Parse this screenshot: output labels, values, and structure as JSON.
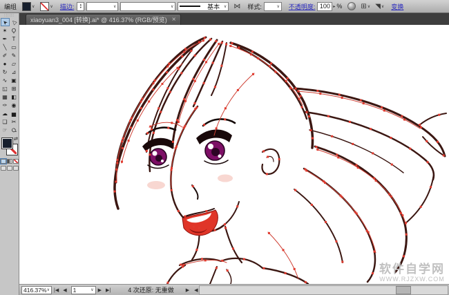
{
  "control_bar": {
    "group_label": "编组",
    "stroke_label": "描边:",
    "brush_name": "基本",
    "style_label": "样式:",
    "opacity_label": "不透明度:",
    "opacity_value": "100",
    "opacity_arrow": "▸",
    "percent_sign": "%",
    "recolor_glyph": "⋈",
    "grid_glyph": "⊞",
    "isolate_glyph": "◥",
    "dropdown_glyph": "∨",
    "transform_label": "变换"
  },
  "tab_bar": {
    "document_title": "xiaoyuan3_004 [转换].ai* @ 416.37% (RGB/预览)",
    "close_glyph": "×"
  },
  "toolbox": {
    "grip_glyph": "∷∷∷",
    "swap_glyph": "⇄",
    "tools": [
      {
        "name": "selection",
        "glyph": "➤"
      },
      {
        "name": "direct-selection",
        "glyph": "▷"
      },
      {
        "name": "magic-wand",
        "glyph": "✶"
      },
      {
        "name": "lasso",
        "glyph": "Ϙ"
      },
      {
        "name": "pen",
        "glyph": "✒"
      },
      {
        "name": "type",
        "glyph": "T"
      },
      {
        "name": "line-segment",
        "glyph": "╲"
      },
      {
        "name": "rectangle",
        "glyph": "▭"
      },
      {
        "name": "paintbrush",
        "glyph": "✐"
      },
      {
        "name": "pencil",
        "glyph": "✎"
      },
      {
        "name": "blob-brush",
        "glyph": "●"
      },
      {
        "name": "eraser",
        "glyph": "▱"
      },
      {
        "name": "rotate",
        "glyph": "↻"
      },
      {
        "name": "scale",
        "glyph": "⊿"
      },
      {
        "name": "width",
        "glyph": "∿"
      },
      {
        "name": "free-transform",
        "glyph": "▣"
      },
      {
        "name": "shape-builder",
        "glyph": "◱"
      },
      {
        "name": "perspective-grid",
        "glyph": "⊞"
      },
      {
        "name": "mesh",
        "glyph": "▦"
      },
      {
        "name": "gradient",
        "glyph": "◧"
      },
      {
        "name": "eyedropper",
        "glyph": "✑"
      },
      {
        "name": "blend",
        "glyph": "◉"
      },
      {
        "name": "symbol-sprayer",
        "glyph": "☁"
      },
      {
        "name": "graph",
        "glyph": "▅"
      },
      {
        "name": "artboard",
        "glyph": "❏"
      },
      {
        "name": "slice",
        "glyph": "✂"
      },
      {
        "name": "hand",
        "glyph": "☞"
      },
      {
        "name": "zoom",
        "glyph": "Q"
      }
    ]
  },
  "status_bar": {
    "zoom_value": "416.37%",
    "first_glyph": "|◀",
    "prev_glyph": "◀",
    "artboard_value": "1",
    "next_glyph": "▶",
    "last_glyph": "▶|",
    "status_text": "4 次还原: 无重做",
    "play_glyph": "▶",
    "scroll_left_glyph": "◀",
    "dropdown_glyph": "∨"
  },
  "watermark": {
    "line1": "软件自学网",
    "line2": "WWW.RJZXW.COM"
  },
  "colors": {
    "anchor": "#e03a2e",
    "line_dark": "#3b1712",
    "line_red": "#cf4034",
    "iris": "#7d0f66",
    "lips": "#e03528",
    "link_blue": "#2a2abf",
    "selected_tool_bg": "#afcce8"
  }
}
